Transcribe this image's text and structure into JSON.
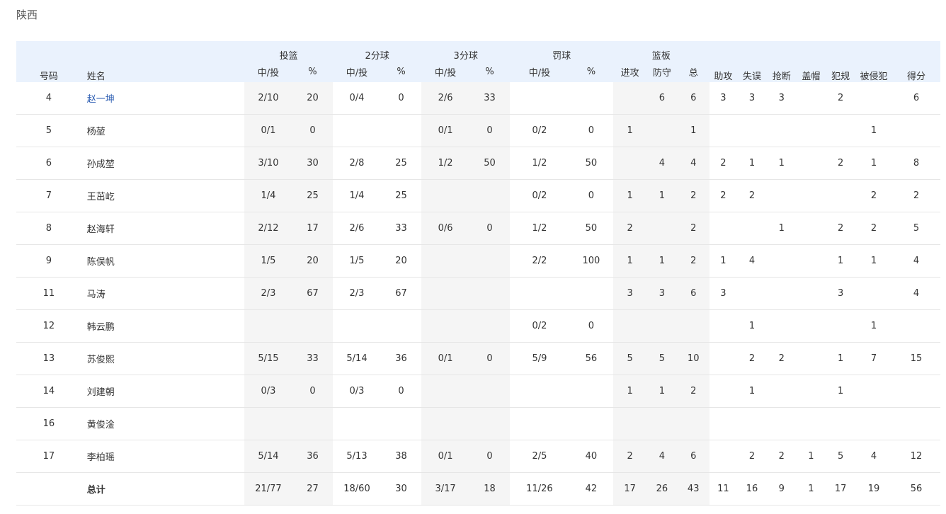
{
  "team_name": "陕西",
  "headers": {
    "number": "号码",
    "name": "姓名",
    "fg": "投篮",
    "two": "2分球",
    "three": "3分球",
    "ft": "罚球",
    "reb": "篮板",
    "made_att": "中/投",
    "pct": "%",
    "oreb": "进攻",
    "dreb": "防守",
    "treb": "总",
    "ast": "助攻",
    "tov": "失误",
    "stl": "抢断",
    "blk": "盖帽",
    "pf": "犯规",
    "fd": "被侵犯",
    "pts": "得分"
  },
  "players": [
    {
      "no": "4",
      "name": "赵一坤",
      "fg": "2/10",
      "fg_pct": "20",
      "two": "0/4",
      "two_pct": "0",
      "three": "2/6",
      "three_pct": "33",
      "ft": "",
      "ft_pct": "",
      "oreb": "",
      "dreb": "6",
      "treb": "6",
      "ast": "3",
      "tov": "3",
      "stl": "3",
      "blk": "",
      "pf": "2",
      "fd": "",
      "pts": "6"
    },
    {
      "no": "5",
      "name": "杨堃",
      "fg": "0/1",
      "fg_pct": "0",
      "two": "",
      "two_pct": "",
      "three": "0/1",
      "three_pct": "0",
      "ft": "0/2",
      "ft_pct": "0",
      "oreb": "1",
      "dreb": "",
      "treb": "1",
      "ast": "",
      "tov": "",
      "stl": "",
      "blk": "",
      "pf": "",
      "fd": "1",
      "pts": ""
    },
    {
      "no": "6",
      "name": "孙成堃",
      "fg": "3/10",
      "fg_pct": "30",
      "two": "2/8",
      "two_pct": "25",
      "three": "1/2",
      "three_pct": "50",
      "ft": "1/2",
      "ft_pct": "50",
      "oreb": "",
      "dreb": "4",
      "treb": "4",
      "ast": "2",
      "tov": "1",
      "stl": "1",
      "blk": "",
      "pf": "2",
      "fd": "1",
      "pts": "8"
    },
    {
      "no": "7",
      "name": "王茁屹",
      "fg": "1/4",
      "fg_pct": "25",
      "two": "1/4",
      "two_pct": "25",
      "three": "",
      "three_pct": "",
      "ft": "0/2",
      "ft_pct": "0",
      "oreb": "1",
      "dreb": "1",
      "treb": "2",
      "ast": "2",
      "tov": "2",
      "stl": "",
      "blk": "",
      "pf": "",
      "fd": "2",
      "pts": "2"
    },
    {
      "no": "8",
      "name": "赵海轩",
      "fg": "2/12",
      "fg_pct": "17",
      "two": "2/6",
      "two_pct": "33",
      "three": "0/6",
      "three_pct": "0",
      "ft": "1/2",
      "ft_pct": "50",
      "oreb": "2",
      "dreb": "",
      "treb": "2",
      "ast": "",
      "tov": "",
      "stl": "1",
      "blk": "",
      "pf": "2",
      "fd": "2",
      "pts": "5"
    },
    {
      "no": "9",
      "name": "陈俣帆",
      "fg": "1/5",
      "fg_pct": "20",
      "two": "1/5",
      "two_pct": "20",
      "three": "",
      "three_pct": "",
      "ft": "2/2",
      "ft_pct": "100",
      "oreb": "1",
      "dreb": "1",
      "treb": "2",
      "ast": "1",
      "tov": "4",
      "stl": "",
      "blk": "",
      "pf": "1",
      "fd": "1",
      "pts": "4"
    },
    {
      "no": "11",
      "name": "马涛",
      "fg": "2/3",
      "fg_pct": "67",
      "two": "2/3",
      "two_pct": "67",
      "three": "",
      "three_pct": "",
      "ft": "",
      "ft_pct": "",
      "oreb": "3",
      "dreb": "3",
      "treb": "6",
      "ast": "3",
      "tov": "",
      "stl": "",
      "blk": "",
      "pf": "3",
      "fd": "",
      "pts": "4"
    },
    {
      "no": "12",
      "name": "韩云鹏",
      "fg": "",
      "fg_pct": "",
      "two": "",
      "two_pct": "",
      "three": "",
      "three_pct": "",
      "ft": "0/2",
      "ft_pct": "0",
      "oreb": "",
      "dreb": "",
      "treb": "",
      "ast": "",
      "tov": "1",
      "stl": "",
      "blk": "",
      "pf": "",
      "fd": "1",
      "pts": ""
    },
    {
      "no": "13",
      "name": "苏俊熙",
      "fg": "5/15",
      "fg_pct": "33",
      "two": "5/14",
      "two_pct": "36",
      "three": "0/1",
      "three_pct": "0",
      "ft": "5/9",
      "ft_pct": "56",
      "oreb": "5",
      "dreb": "5",
      "treb": "10",
      "ast": "",
      "tov": "2",
      "stl": "2",
      "blk": "",
      "pf": "1",
      "fd": "7",
      "pts": "15"
    },
    {
      "no": "14",
      "name": "刘建朝",
      "fg": "0/3",
      "fg_pct": "0",
      "two": "0/3",
      "two_pct": "0",
      "three": "",
      "three_pct": "",
      "ft": "",
      "ft_pct": "",
      "oreb": "1",
      "dreb": "1",
      "treb": "2",
      "ast": "",
      "tov": "1",
      "stl": "",
      "blk": "",
      "pf": "1",
      "fd": "",
      "pts": ""
    },
    {
      "no": "16",
      "name": "黄俊淦",
      "fg": "",
      "fg_pct": "",
      "two": "",
      "two_pct": "",
      "three": "",
      "three_pct": "",
      "ft": "",
      "ft_pct": "",
      "oreb": "",
      "dreb": "",
      "treb": "",
      "ast": "",
      "tov": "",
      "stl": "",
      "blk": "",
      "pf": "",
      "fd": "",
      "pts": ""
    },
    {
      "no": "17",
      "name": "李柏瑶",
      "fg": "5/14",
      "fg_pct": "36",
      "two": "5/13",
      "two_pct": "38",
      "three": "0/1",
      "three_pct": "0",
      "ft": "2/5",
      "ft_pct": "40",
      "oreb": "2",
      "dreb": "4",
      "treb": "6",
      "ast": "",
      "tov": "2",
      "stl": "2",
      "blk": "1",
      "pf": "5",
      "fd": "4",
      "pts": "12"
    }
  ],
  "total": {
    "no": "",
    "name": "总计",
    "fg": "21/77",
    "fg_pct": "27",
    "two": "18/60",
    "two_pct": "30",
    "three": "3/17",
    "three_pct": "18",
    "ft": "11/26",
    "ft_pct": "42",
    "oreb": "17",
    "dreb": "26",
    "treb": "43",
    "ast": "11",
    "tov": "16",
    "stl": "9",
    "blk": "1",
    "pf": "17",
    "fd": "19",
    "pts": "56"
  },
  "colors": {
    "header_bg": "#eaf2fd",
    "shade_bg": "#f5f5f5",
    "link": "#2f5fb3",
    "divider": "#e6e6e6"
  }
}
